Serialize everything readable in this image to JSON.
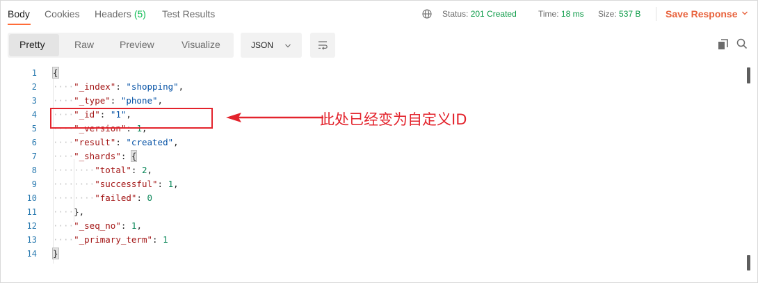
{
  "tabs": [
    {
      "label": "Body",
      "active": true
    },
    {
      "label": "Cookies",
      "active": false
    },
    {
      "label": "Headers",
      "count": "(5)",
      "active": false
    },
    {
      "label": "Test Results",
      "active": false
    }
  ],
  "status": {
    "status_label": "Status:",
    "status_value": "201 Created",
    "time_label": "Time:",
    "time_value": "18 ms",
    "size_label": "Size:",
    "size_value": "537 B",
    "save_label": "Save Response"
  },
  "view_modes": [
    "Pretty",
    "Raw",
    "Preview",
    "Visualize"
  ],
  "active_view": "Pretty",
  "format": "JSON",
  "icons": {
    "globe": "globe-icon",
    "chevron": "chevron-down-icon",
    "wrap": "wrap-lines-icon",
    "copy": "copy-icon",
    "search": "search-icon"
  },
  "colors": {
    "accent": "#ff6c37",
    "status_ok": "#0a9a46",
    "save": "#e8623c",
    "annotation": "#e3232c",
    "line_number": "#2a7ab0",
    "json_key": "#a31515",
    "json_string": "#0451a5",
    "json_number": "#098658"
  },
  "code_lines": [
    {
      "num": "1",
      "indent": "",
      "brace": "{"
    },
    {
      "num": "2",
      "indent": "····",
      "key": "\"_index\"",
      "sep": ": ",
      "str": "\"shopping\"",
      "tail": ","
    },
    {
      "num": "3",
      "indent": "····",
      "key": "\"_type\"",
      "sep": ": ",
      "str": "\"phone\"",
      "tail": ","
    },
    {
      "num": "4",
      "indent": "····",
      "key": "\"_id\"",
      "sep": ": ",
      "str": "\"1\"",
      "tail": ","
    },
    {
      "num": "5",
      "indent": "····",
      "key": "\"_version\"",
      "sep": ": ",
      "num_val": "1",
      "tail": ","
    },
    {
      "num": "6",
      "indent": "····",
      "key": "\"result\"",
      "sep": ": ",
      "str": "\"created\"",
      "tail": ","
    },
    {
      "num": "7",
      "indent": "····",
      "key": "\"_shards\"",
      "sep": ": ",
      "brace": "{"
    },
    {
      "num": "8",
      "indent": "········",
      "key": "\"total\"",
      "sep": ": ",
      "num_val": "2",
      "tail": ","
    },
    {
      "num": "9",
      "indent": "········",
      "key": "\"successful\"",
      "sep": ": ",
      "num_val": "1",
      "tail": ","
    },
    {
      "num": "10",
      "indent": "········",
      "key": "\"failed\"",
      "sep": ": ",
      "num_val": "0"
    },
    {
      "num": "11",
      "indent": "····",
      "tail": "},"
    },
    {
      "num": "12",
      "indent": "····",
      "key": "\"_seq_no\"",
      "sep": ": ",
      "num_val": "1",
      "tail": ","
    },
    {
      "num": "13",
      "indent": "····",
      "key": "\"_primary_term\"",
      "sep": ": ",
      "num_val": "1"
    },
    {
      "num": "14",
      "indent": "",
      "brace": "}"
    }
  ],
  "annotation": "此处已经变为自定义ID"
}
